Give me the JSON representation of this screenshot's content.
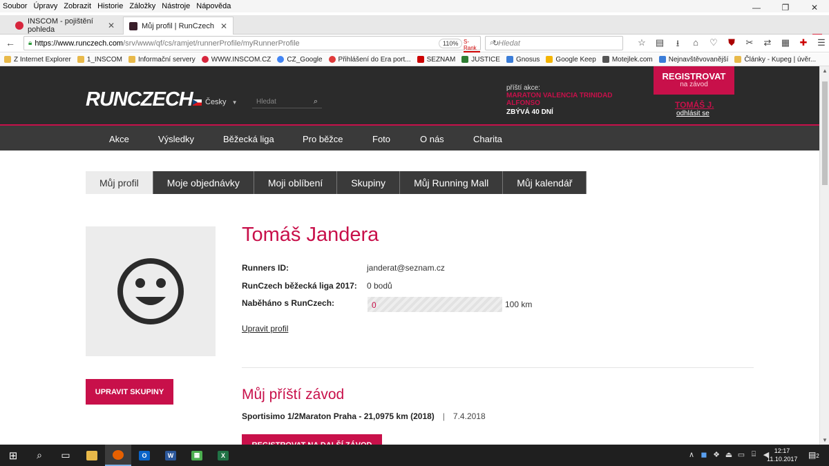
{
  "browser": {
    "menu": [
      "Soubor",
      "Úpravy",
      "Zobrazit",
      "Historie",
      "Záložky",
      "Nástroje",
      "Nápověda"
    ],
    "tabs": [
      {
        "title": "INSCOM - pojištění pohleda",
        "favicon_color": "#d7263d",
        "active": false
      },
      {
        "title": "Můj profil | RunCzech",
        "favicon_color": "#3a1f2b",
        "active": true
      }
    ],
    "url_host": "https://www.runczech.com",
    "url_rest": "/srv/www/qf/cs/ramjet/runnerProfile/myRunnerProfile",
    "zoom": "110%",
    "srank": "S-Rank",
    "search_placeholder": "Hledat",
    "bookmarks": [
      {
        "label": "Z Internet Explorer",
        "color": "#e8b94a"
      },
      {
        "label": "1_INSCOM",
        "color": "#e8b94a"
      },
      {
        "label": "Informační servery",
        "color": "#e8b94a"
      },
      {
        "label": "WWW.INSCOM.CZ",
        "color": "#d7263d"
      },
      {
        "label": "CZ_Google",
        "color": "#4285f4"
      },
      {
        "label": "Přihlášení do Era port...",
        "color": "#e03a3a"
      },
      {
        "label": "SEZNAM",
        "color": "#cc0000"
      },
      {
        "label": "JUSTICE",
        "color": "#2e7d32"
      },
      {
        "label": "Gnosus",
        "color": "#3b7dd8"
      },
      {
        "label": "Google Keep",
        "color": "#f4b400"
      },
      {
        "label": "Motejlek.com",
        "color": "#555555"
      },
      {
        "label": "Nejnavštěvovanější",
        "color": "#3b7dd8"
      },
      {
        "label": "Články - Kupeg | úvěr...",
        "color": "#e8b94a"
      }
    ]
  },
  "site": {
    "logo": "RUNCZECH",
    "language": "Česky",
    "search_placeholder": "Hledat",
    "next_event_label": "příští akce:",
    "next_event_name": "MARATON VALENCIA TRINIDAD ALFONSO",
    "next_event_days": "ZBÝVÁ 40 DNÍ",
    "register_line1": "REGISTROVAT",
    "register_line2": "na závod",
    "user_name": "TOMÁŠ J.",
    "logout": "odhlásit se",
    "nav": [
      "Akce",
      "Výsledky",
      "Běžecká liga",
      "Pro běžce",
      "Foto",
      "O nás",
      "Charita"
    ],
    "accent": "#c8104a"
  },
  "profile": {
    "tabs": [
      "Můj profil",
      "Moje objednávky",
      "Moji oblíbení",
      "Skupiny",
      "Můj Running Mall",
      "Můj kalendář"
    ],
    "name": "Tomáš Jandera",
    "runners_id_label": "Runners ID:",
    "runners_id": "janderat@seznam.cz",
    "league_label": "RunCzech běžecká liga 2017:",
    "league_points": "0 bodů",
    "km_label": "Naběháno s RunCzech:",
    "km_current": "0",
    "km_target": "100 km",
    "km_fraction": 0,
    "edit_profile": "Upravit profil",
    "edit_groups": "UPRAVIT SKUPINY",
    "next_race_title": "Můj příští závod",
    "next_race_name": "Sportisimo 1/2Maraton Praha - 21,0975 km (2018)",
    "next_race_sep": "|",
    "next_race_date": "7.4.2018",
    "register_more": "REGISTROVAT NA DALŠÍ ZÁVOD"
  },
  "taskbar": {
    "time": "12:17",
    "date": "11.10.2017",
    "notifications": "2"
  }
}
